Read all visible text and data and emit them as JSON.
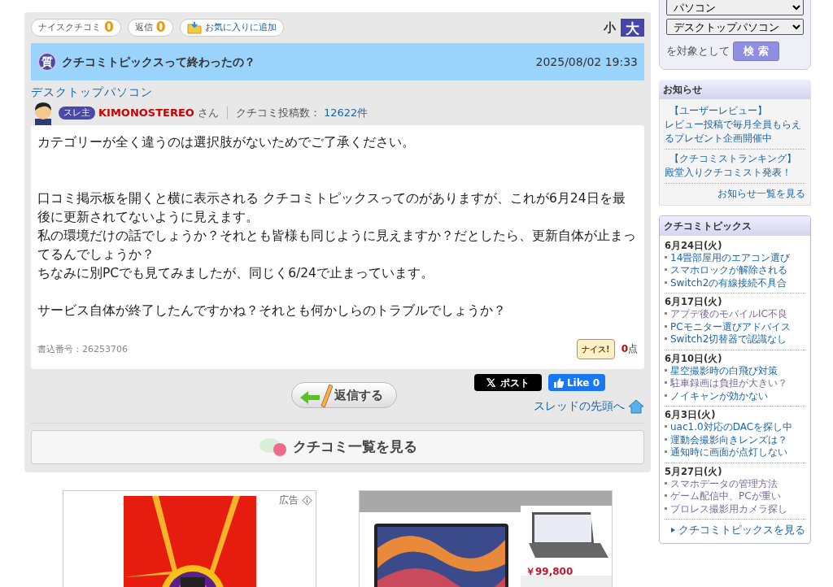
{
  "thread_toolbar": {
    "nice_label": "ナイスクチコミ",
    "nice_count": "0",
    "reply_label": "返信",
    "reply_count": "0",
    "favorite": "お気に入りに追加",
    "font_sizes": [
      {
        "label": "小",
        "selected": false
      },
      {
        "label": "大",
        "selected": true
      }
    ]
  },
  "thread": {
    "badge": "質",
    "title": "クチコミトピックスって終わったの？",
    "date": "2025/08/02 19:33",
    "category": "デスクトップパソコン",
    "author": {
      "role": "スレ主",
      "name": "KIMONOSTEREO",
      "suffix": "さん",
      "posts_label": "クチコミ投稿数：",
      "posts": "12622件"
    },
    "paragraphs": [
      [
        "カテゴリーが全く違うのは選択肢がないためでご了承ください。"
      ],
      [
        "口コミ掲示板を開くと横に表示される クチコミトピックスってのがありますが、これが6月24日を最後に更新されてないように見えます。",
        "私の環境だけの話でしょうか？それとも皆様も同じように見えますか？だとしたら、更新自体が止まってるんでしょうか？",
        "ちなみに別PCでも見てみましたが、同じく6/24で止まっています。"
      ],
      [
        "サービス自体が終了したんですかね？それとも何かしらのトラブルでしょうか？"
      ]
    ],
    "post_number": "書込番号：26253706",
    "nice_button": "ナイス!",
    "points": "0",
    "points_unit": "点"
  },
  "actions": {
    "reply": "返信する",
    "x_post": "ポスト",
    "like": "Like 0",
    "to_top": "スレッドの先頭へ",
    "list": "クチコミ一覧を見る"
  },
  "ads": {
    "label": "広告",
    "price": "￥99,800"
  },
  "sidebar": {
    "search": {
      "selects": [
        "パソコン",
        "デスクトップパソコン"
      ],
      "suffix": "を対象として",
      "button": "検 索"
    },
    "news": {
      "title": "お知らせ",
      "items": [
        [
          "【ユーザーレビュー】",
          "レビュー投稿で毎月全員もらえるプレゼント企画開催中"
        ],
        [
          "【クチコミストランキング】",
          "殿堂入りクチコミスト発表！"
        ]
      ],
      "more": "お知らせ一覧を見る"
    },
    "topics": {
      "title": "クチコミトピックス",
      "groups": [
        {
          "date": "6月24日(火)",
          "items": [
            {
              "text": "14畳部屋用のエアコン選び",
              "visited": false
            },
            {
              "text": "スマホロックが解除される",
              "visited": false
            },
            {
              "text": "Switch2の有線接続不具合",
              "visited": false
            }
          ]
        },
        {
          "date": "6月17日(火)",
          "items": [
            {
              "text": "アプデ後のモバイルIC不良",
              "visited": true
            },
            {
              "text": "PCモニター選びアドバイス",
              "visited": false
            },
            {
              "text": "Switch2切替器で認識なし",
              "visited": false
            }
          ]
        },
        {
          "date": "6月10日(火)",
          "items": [
            {
              "text": "星空撮影時の白飛び対策",
              "visited": false
            },
            {
              "text": "駐車録画は負担が大きい？",
              "visited": true
            },
            {
              "text": "ノイキャンが効かない",
              "visited": false
            }
          ]
        },
        {
          "date": "6月3日(火)",
          "items": [
            {
              "text": "uac1.0対応のDACを探し中",
              "visited": false
            },
            {
              "text": "運動会撮影向きレンズは？",
              "visited": false
            },
            {
              "text": "通知時に画面が点灯しない",
              "visited": false
            }
          ]
        },
        {
          "date": "5月27日(火)",
          "items": [
            {
              "text": "スマホデータの管理方法",
              "visited": true
            },
            {
              "text": "ゲーム配信中、PCが重い",
              "visited": true
            },
            {
              "text": "プロレス撮影用カメラ探し",
              "visited": true
            }
          ]
        }
      ],
      "more": "クチコミトピックスを見る"
    }
  }
}
